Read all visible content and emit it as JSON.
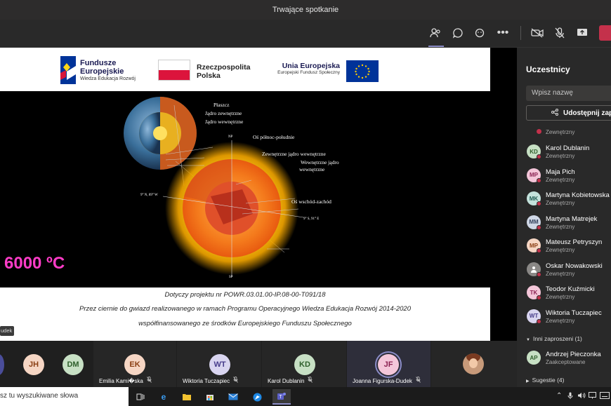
{
  "window": {
    "title": "Trwające spotkanie"
  },
  "slide": {
    "logos": {
      "fe_title": "Fundusze",
      "fe_title2": "Europejskie",
      "fe_sub": "Wiedza Edukacja Rozwój",
      "rp_title": "Rzeczpospolita",
      "rp_title2": "Polska",
      "ue_title": "Unia Europejska",
      "ue_sub": "Europejski Fundusz Społeczny"
    },
    "labels": {
      "plaszcz": "Płaszcz",
      "jadro_zew": "Jądro zewnętrzne",
      "jadro_wew": "Jądro wewnętrzne",
      "os_pn": "Oś północ-południe",
      "zew_jadro_wew": "Zewnętrzne jądro wewnętrzne",
      "wew_jadro_1": "Wewnętrzne jądro",
      "wew_jadro_2": "wewnętrzne",
      "os_wz": "Oś wschód-zachód",
      "np": "NP",
      "sp": "SP",
      "coord_w": "9° N, 89° W",
      "coord_e": "9° S, 91° E"
    },
    "temperature": "6000 ºC",
    "footer": {
      "line1": "Dotyczy projektu nr POWR.03.01.00-IP.08-00-T091/18",
      "line2": "Przez ciernie do gwiazd realizowanego w ramach Programu Operacyjnego Wiedza Edukacja Rozwój 2014-2020",
      "line3": "współfinansowanego ze środków Europejskiego Funduszu Społecznego"
    },
    "name_badge": "udek"
  },
  "panel": {
    "title": "Uczestnicy",
    "search_placeholder": "Wpisz nazwę",
    "share_label": "Udostępnij zapro",
    "top_sub": "Zewnętrzny",
    "participants": [
      {
        "initials": "KD",
        "name": "Karol Dublanin",
        "sub": "Zewnętrzny",
        "bg": "#c7e0c4",
        "fg": "#2e5f2b"
      },
      {
        "initials": "MP",
        "name": "Maja Pich",
        "sub": "Zewnętrzny",
        "bg": "#f4c6d9",
        "fg": "#8b2252"
      },
      {
        "initials": "MK",
        "name": "Martyna Kobietowska",
        "sub": "Zewnętrzny",
        "bg": "#c4e2dc",
        "fg": "#1f5c52"
      },
      {
        "initials": "MM",
        "name": "Martyna Matrejek",
        "sub": "Zewnętrzny",
        "bg": "#cfd7e6",
        "fg": "#33415c"
      },
      {
        "initials": "MP",
        "name": "Mateusz Petryszyn",
        "sub": "Zewnętrzny",
        "bg": "#f6d6c4",
        "fg": "#8a3e12"
      },
      {
        "initials": "",
        "name": "Oskar Nowakowski",
        "sub": "Zewnętrzny",
        "bg": "#8a8886",
        "fg": "#ffffff"
      },
      {
        "initials": "TK",
        "name": "Teodor Kuźmicki",
        "sub": "Zewnętrzny",
        "bg": "#f4c6d9",
        "fg": "#8b2252"
      },
      {
        "initials": "WT",
        "name": "Wiktoria Tuczapiec",
        "sub": "Zewnętrzny",
        "bg": "#d9d5f0",
        "fg": "#463c8a"
      }
    ],
    "invited_section": "Inni zaproszeni (1)",
    "invited": {
      "initials": "AP",
      "name": "Andrzej Pieczonka",
      "sub": "Zaakceptowane",
      "bg": "#c7e0c4",
      "fg": "#2e5f2b"
    },
    "suggestions_section": "Sugestie (4)"
  },
  "gallery": {
    "tiles": [
      {
        "initials": "JH",
        "name": "",
        "bg": "#f6d6c4",
        "fg": "#8a3e12"
      },
      {
        "initials": "DM",
        "name": "",
        "bg": "#c7e0c4",
        "fg": "#2e5f2b"
      },
      {
        "initials": "EK",
        "name": "Emilia Kami�ska",
        "bg": "#f6d6c4",
        "fg": "#8a3e12"
      },
      {
        "initials": "WT",
        "name": "Wiktoria Tuczapiec",
        "bg": "#d9d5f0",
        "fg": "#463c8a"
      },
      {
        "initials": "KD",
        "name": "Karol Dublanin",
        "bg": "#c7e0c4",
        "fg": "#2e5f2b"
      },
      {
        "initials": "JF",
        "name": "Joanna Figurska-Dudek",
        "bg": "#f4c6d9",
        "fg": "#8b2252"
      }
    ]
  },
  "taskbar": {
    "search_text": "sz tu wyszukiwane słowa"
  },
  "colors": {
    "accent": "#6264a7",
    "leave": "#c4314b",
    "temp": "#ff3cc8"
  }
}
